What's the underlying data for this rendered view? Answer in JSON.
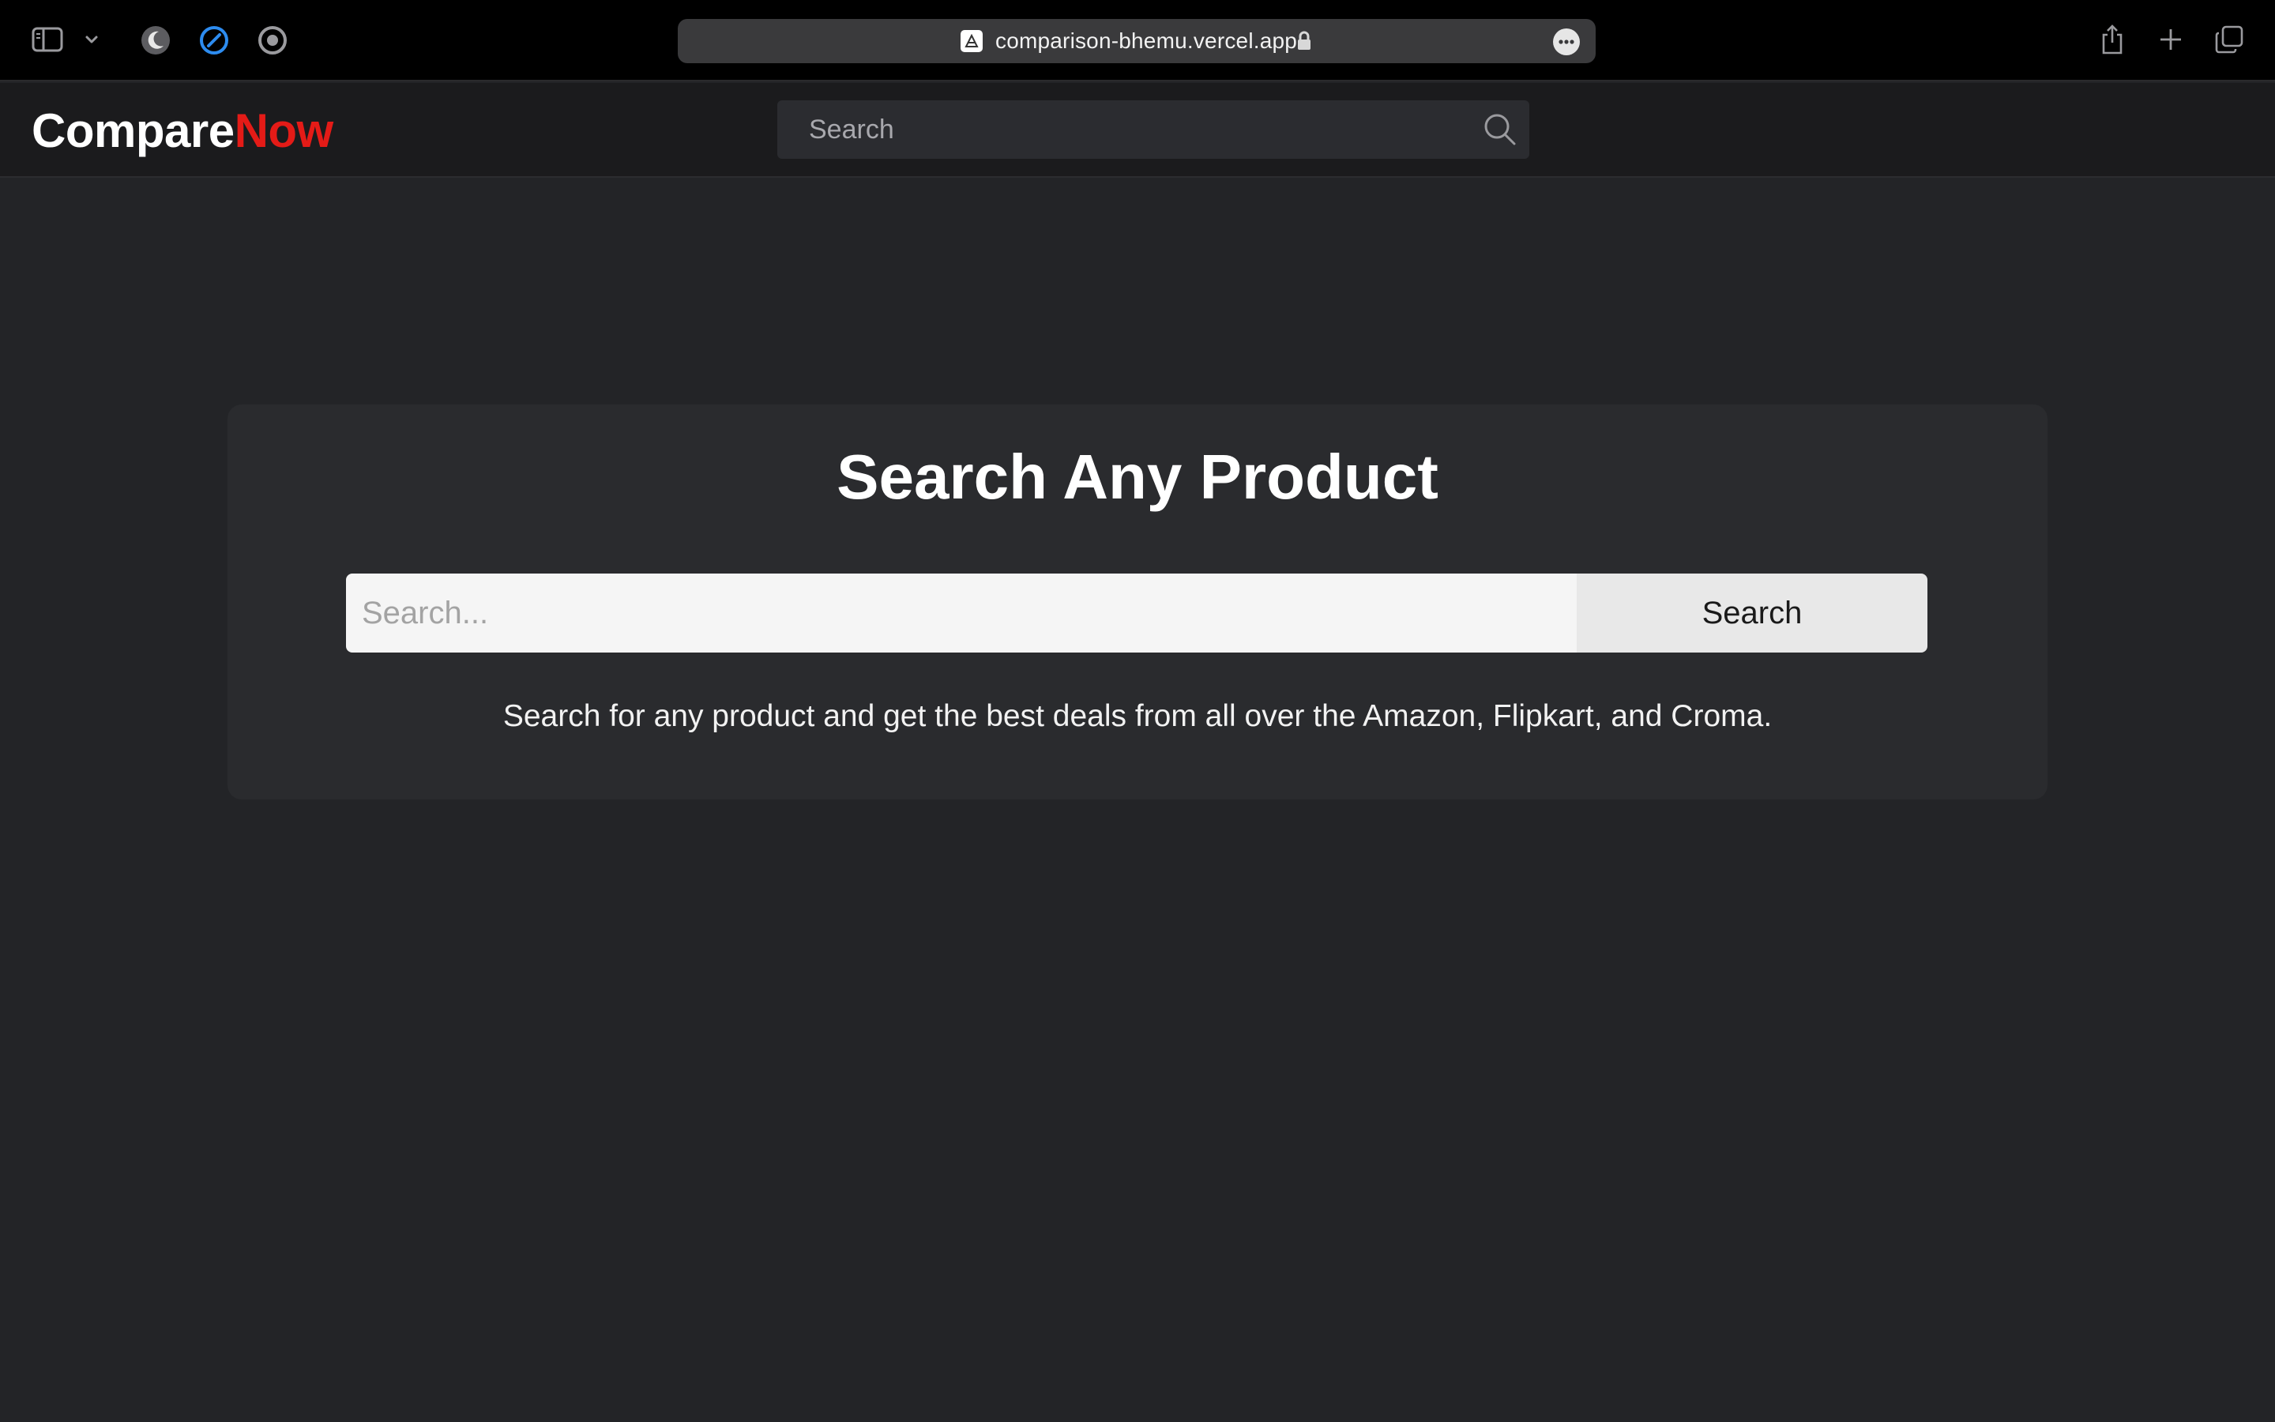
{
  "browser": {
    "url": "comparison-bhemu.vercel.app",
    "icons": [
      "sidebar-icon",
      "chevron-down-icon",
      "moon-icon",
      "compass-icon",
      "record-icon",
      "lock-icon",
      "more-icon",
      "share-icon",
      "plus-icon",
      "tabs-icon"
    ]
  },
  "header": {
    "logo_part1": "Compare",
    "logo_part2": "Now",
    "search_placeholder": "Search",
    "colors": {
      "logo_accent": "#e41b17",
      "header_bg": "#1b1b1d"
    }
  },
  "main": {
    "title": "Search Any Product",
    "search_placeholder": "Search...",
    "search_button": "Search",
    "description": "Search for any product and get the best deals from all over the Amazon, Flipkart, and Croma."
  }
}
